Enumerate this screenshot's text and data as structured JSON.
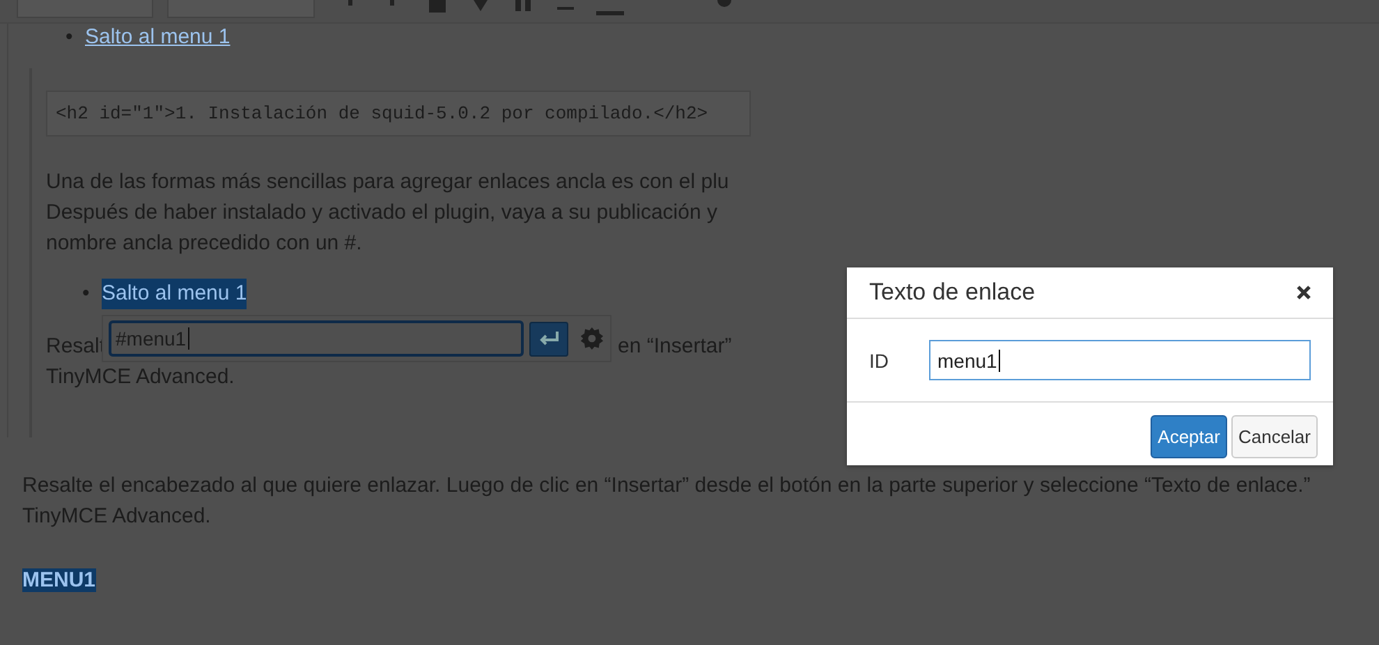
{
  "top_list": [
    {
      "bullet": "•",
      "text": "Salto al menu 1"
    }
  ],
  "code_block": "<h2 id=\"1\">1. Instalación de squid-5.0.2 por compilado.</h2>",
  "paragraph_lines": [
    "Una de las formas más sencillas para agregar enlaces ancla es con el plu",
    "Después de haber instalado y activado el plugin, vaya a su publicación y",
    "nombre ancla precedido con un #."
  ],
  "anchor_item": {
    "bullet": "•",
    "text": "Salto al menu 1",
    "selected": true
  },
  "link_popup": {
    "value": "#menu1"
  },
  "covered_line": {
    "before": "Resalt",
    "after": "en “Insertar”"
  },
  "covered_line_2": "TinyMCE Advanced.",
  "body_lines": [
    "Resalte el encabezado al que quiere enlazar. Luego de clic en “Insertar” desde el botón en la parte superior y seleccione “Texto de enlace.”",
    "TinyMCE Advanced."
  ],
  "heading": {
    "text": "MENU1",
    "selected": true
  },
  "dialog": {
    "title": "Texto de enlace",
    "fields": [
      {
        "label": "ID",
        "value": "menu1"
      }
    ],
    "buttons": [
      {
        "label": "Aceptar",
        "kind": "primary"
      },
      {
        "label": "Cancelar",
        "kind": "secondary"
      }
    ]
  }
}
